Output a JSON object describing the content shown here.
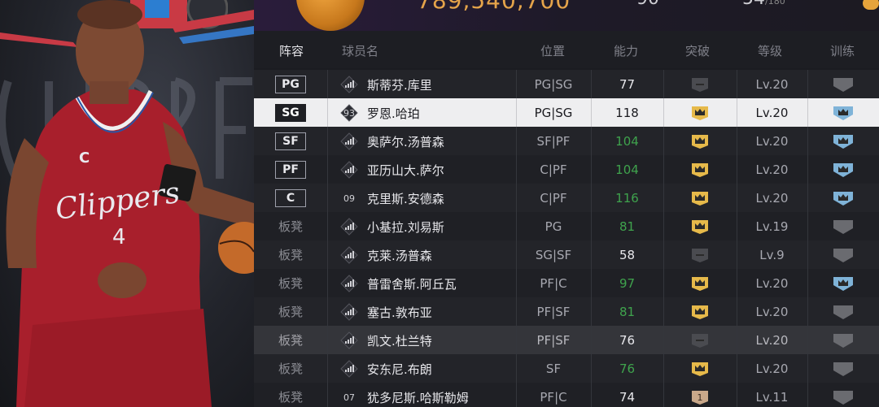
{
  "top_bar": {
    "currency": "789,540,700",
    "stat1": "90",
    "stat2": "54",
    "stat2_sub": "/180"
  },
  "header": {
    "lineup": "阵容",
    "name": "球员名",
    "position": "位置",
    "ability": "能力",
    "breakthrough": "突破",
    "level": "等级",
    "training": "训练"
  },
  "colors": {
    "accent_gold": "#e6b94a",
    "up_green": "#3fa34d",
    "shield_blue": "#7fb3d8",
    "shield_gray": "#6a6b70"
  },
  "rows": [
    {
      "slot": "PG",
      "badge": true,
      "jersey": "",
      "icon": "bars",
      "name": "斯蒂芬.库里",
      "pos": "PG|SG",
      "rating": "77",
      "up": false,
      "break": "gray",
      "level": "Lv.20",
      "train": "gray"
    },
    {
      "slot": "SG",
      "badge": true,
      "jersey": "93",
      "icon": "diamond",
      "name": "罗恩.哈珀",
      "pos": "PG|SG",
      "rating": "118",
      "up": false,
      "break": "gold",
      "level": "Lv.20",
      "train": "blue",
      "selected": true
    },
    {
      "slot": "SF",
      "badge": true,
      "jersey": "",
      "icon": "bars",
      "name": "奥萨尔.汤普森",
      "pos": "SF|PF",
      "rating": "104",
      "up": true,
      "break": "gold",
      "level": "Lv.20",
      "train": "blue"
    },
    {
      "slot": "PF",
      "badge": true,
      "jersey": "",
      "icon": "bars",
      "name": "亚历山大.萨尔",
      "pos": "C|PF",
      "rating": "104",
      "up": true,
      "break": "gold",
      "level": "Lv.20",
      "train": "blue"
    },
    {
      "slot": "C",
      "badge": true,
      "jersey": "09",
      "icon": "num",
      "name": "克里斯.安德森",
      "pos": "C|PF",
      "rating": "116",
      "up": true,
      "break": "gold",
      "level": "Lv.20",
      "train": "blue"
    },
    {
      "slot": "板凳",
      "badge": false,
      "jersey": "",
      "icon": "bars",
      "name": "小基拉.刘易斯",
      "pos": "PG",
      "rating": "81",
      "up": true,
      "break": "gold",
      "level": "Lv.19",
      "train": "gray"
    },
    {
      "slot": "板凳",
      "badge": false,
      "jersey": "",
      "icon": "bars",
      "name": "克莱.汤普森",
      "pos": "SG|SF",
      "rating": "58",
      "up": false,
      "break": "gray",
      "level": "Lv.9",
      "train": "gray"
    },
    {
      "slot": "板凳",
      "badge": false,
      "jersey": "",
      "icon": "bars",
      "name": "普雷舍斯.阿丘瓦",
      "pos": "PF|C",
      "rating": "97",
      "up": true,
      "break": "gold",
      "level": "Lv.20",
      "train": "blue"
    },
    {
      "slot": "板凳",
      "badge": false,
      "jersey": "",
      "icon": "bars",
      "name": "塞古.敦布亚",
      "pos": "PF|SF",
      "rating": "81",
      "up": true,
      "break": "gold",
      "level": "Lv.20",
      "train": "gray"
    },
    {
      "slot": "板凳",
      "badge": false,
      "jersey": "",
      "icon": "bars",
      "name": "凯文.杜兰特",
      "pos": "PF|SF",
      "rating": "76",
      "up": false,
      "break": "gray",
      "level": "Lv.20",
      "train": "gray",
      "dim": true
    },
    {
      "slot": "板凳",
      "badge": false,
      "jersey": "",
      "icon": "bars",
      "name": "安东尼.布朗",
      "pos": "SF",
      "rating": "76",
      "up": true,
      "break": "gold",
      "level": "Lv.20",
      "train": "gray"
    },
    {
      "slot": "板凳",
      "badge": false,
      "jersey": "07",
      "icon": "num",
      "name": "犹多尼斯.哈斯勒姆",
      "pos": "PF|C",
      "rating": "74",
      "up": false,
      "break": "bronze",
      "level": "Lv.11",
      "train": "gray"
    }
  ]
}
